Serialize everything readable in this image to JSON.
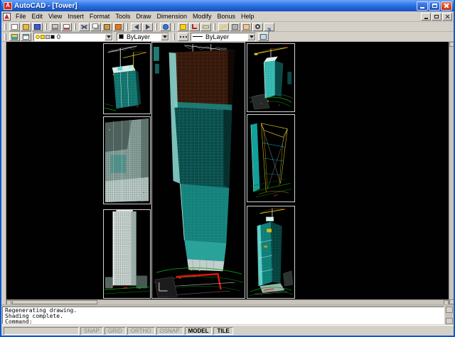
{
  "window": {
    "title": "AutoCAD - [Tower]"
  },
  "menu": {
    "items": [
      "File",
      "Edit",
      "View",
      "Insert",
      "Format",
      "Tools",
      "Draw",
      "Dimension",
      "Modify",
      "Bonus",
      "Help"
    ]
  },
  "toolbar_standard": {
    "buttons": [
      "|",
      "new",
      "open",
      "save",
      "|",
      "print",
      "spell",
      "|",
      "cut",
      "copy",
      "paste",
      "match",
      "|",
      "undo",
      "redo",
      "|",
      "browser",
      "|",
      "osnap",
      "ucs",
      "distance",
      "|",
      "redraw",
      "aerial",
      "pan",
      "zoom",
      "help"
    ]
  },
  "object_properties": {
    "layer_value": "0",
    "color_value": "ByLayer",
    "linetype_value": "ByLayer"
  },
  "command_line": {
    "lines": [
      "Regenerating drawing.",
      "Shading complete.",
      "Command:"
    ]
  },
  "status_bar": {
    "toggles": [
      {
        "label": "SNAP",
        "active": false
      },
      {
        "label": "GRID",
        "active": false
      },
      {
        "label": "ORTHO",
        "active": false
      },
      {
        "label": "OSNAP",
        "active": false
      },
      {
        "label": "MODEL",
        "active": true
      },
      {
        "label": "TILE",
        "active": true
      }
    ]
  },
  "colors": {
    "titlebar_top": "#6ba6f7",
    "titlebar_bottom": "#1450b8",
    "close_button": "#c22f0e",
    "chrome": "#d4d0c8",
    "canvas_bg": "#010101",
    "viewport_border": "#d2d2d2",
    "model_cyan": "#158079",
    "model_green": "#0aa00a",
    "model_red": "#ee1010",
    "model_yellow": "#f0c000"
  }
}
